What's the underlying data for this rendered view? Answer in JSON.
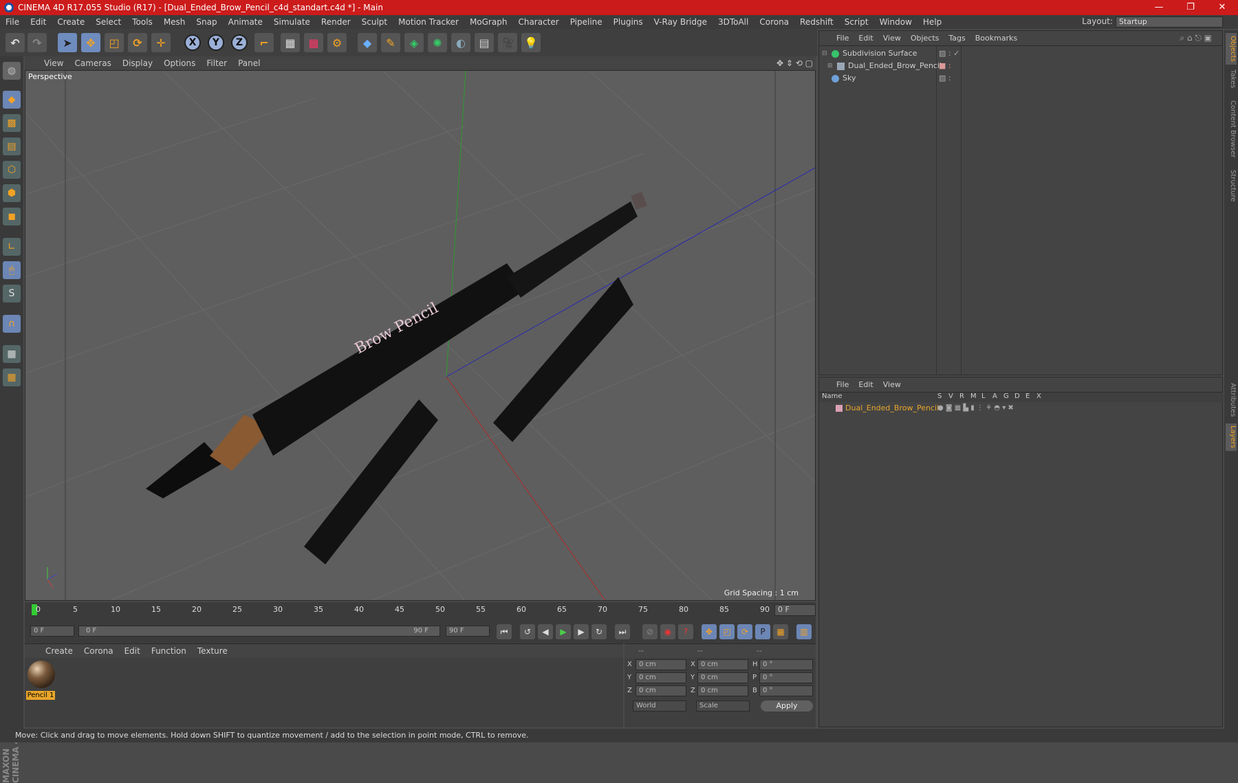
{
  "window": {
    "title": "CINEMA 4D R17.055 Studio (R17) - [Dual_Ended_Brow_Pencil_c4d_standart.c4d *] - Main",
    "controls": [
      "—",
      "❐",
      "✕"
    ]
  },
  "menubar": {
    "items": [
      "File",
      "Edit",
      "Create",
      "Select",
      "Tools",
      "Mesh",
      "Snap",
      "Animate",
      "Simulate",
      "Render",
      "Sculpt",
      "Motion Tracker",
      "MoGraph",
      "Character",
      "Pipeline",
      "Plugins",
      "V-Ray Bridge",
      "3DToAll",
      "Corona",
      "Redshift",
      "Script",
      "Window",
      "Help"
    ],
    "layout_label": "Layout:",
    "layout_value": "Startup"
  },
  "toolbar": {
    "axes": [
      "X",
      "Y",
      "Z"
    ]
  },
  "viewport": {
    "menu": [
      "View",
      "Cameras",
      "Display",
      "Options",
      "Filter",
      "Panel"
    ],
    "label": "Perspective",
    "grid_spacing": "Grid Spacing : 1 cm",
    "pencil_text": "Brow Pencil"
  },
  "timeline": {
    "ticks": [
      "0",
      "5",
      "10",
      "15",
      "20",
      "25",
      "30",
      "35",
      "40",
      "45",
      "50",
      "55",
      "60",
      "65",
      "70",
      "75",
      "80",
      "85",
      "90"
    ],
    "current_frame": "0 F",
    "start_field": "0 F",
    "range_start": "0 F",
    "range_end": "90 F",
    "end_field": "90 F"
  },
  "materials": {
    "menu": [
      "Create",
      "Corona",
      "Edit",
      "Function",
      "Texture"
    ],
    "items": [
      {
        "name": "Pencil 1"
      }
    ]
  },
  "coords": {
    "headers": [
      "--",
      "--",
      "--"
    ],
    "rows": [
      {
        "axis": "X",
        "pos": "0 cm",
        "axis2": "X",
        "size": "0 cm",
        "rot_label": "H",
        "rot": "0 °"
      },
      {
        "axis": "Y",
        "pos": "0 cm",
        "axis2": "Y",
        "size": "0 cm",
        "rot_label": "P",
        "rot": "0 °"
      },
      {
        "axis": "Z",
        "pos": "0 cm",
        "axis2": "Z",
        "size": "0 cm",
        "rot_label": "B",
        "rot": "0 °"
      }
    ],
    "mode1": "World",
    "mode2": "Scale",
    "apply": "Apply"
  },
  "status": "Move: Click and drag to move elements. Hold down SHIFT to quantize movement / add to the selection in point mode, CTRL to remove.",
  "object_manager": {
    "menu": [
      "File",
      "Edit",
      "View",
      "Objects",
      "Tags",
      "Bookmarks"
    ],
    "objects": [
      {
        "name": "Subdivision Surface",
        "color": "#39c26c"
      },
      {
        "name": "Dual_Ended_Brow_Pencil",
        "color": "#9aa6b6"
      },
      {
        "name": "Sky",
        "color": "#6fa0d8"
      }
    ]
  },
  "layer_manager": {
    "menu": [
      "File",
      "Edit",
      "View"
    ],
    "columns": [
      "Name",
      "S",
      "V",
      "R",
      "M",
      "L",
      "A",
      "G",
      "D",
      "E",
      "X"
    ],
    "layers": [
      {
        "name": "Dual_Ended_Brow_Pencil",
        "color": "#e8a52a"
      }
    ]
  },
  "right_tabs": [
    "Objects",
    "Takes",
    "Content Browser",
    "Structure",
    "Attributes",
    "Layers"
  ],
  "maxon_logo": "MAXON CINEMA 4D"
}
